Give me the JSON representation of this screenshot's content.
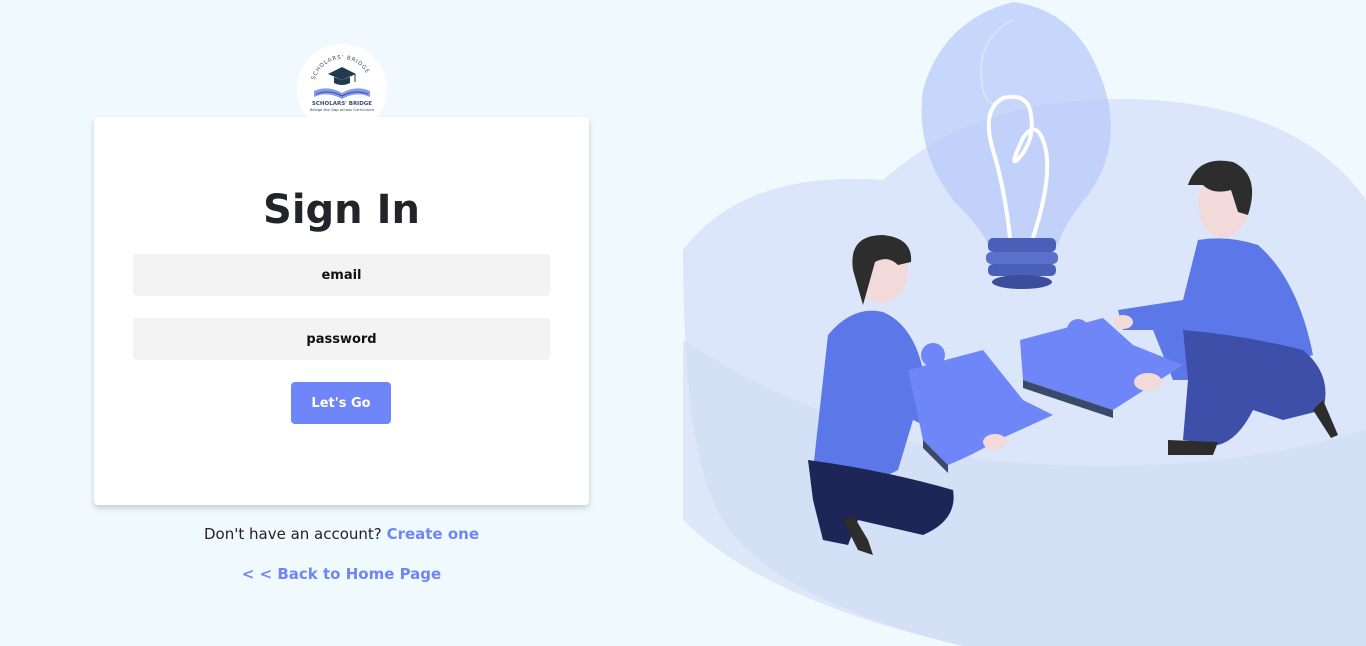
{
  "logo": {
    "arc_text": "SCHOLARS' BRIDGE",
    "name": "SCHOLARS' BRIDGE",
    "tagline": "Bridge the Gap across Curriculum"
  },
  "signin": {
    "title": "Sign In",
    "email_placeholder": "email",
    "password_placeholder": "password",
    "submit_label": "Let's Go"
  },
  "footer": {
    "no_account_text": "Don't have an account?",
    "create_link": "Create one",
    "back_link": "< < Back to Home Page"
  },
  "colors": {
    "accent": "#6e86f7",
    "background": "#f0fafe",
    "blob": "#dbe6fb"
  },
  "illustration": {
    "icon": "teamwork-puzzle-lightbulb-illustration"
  }
}
